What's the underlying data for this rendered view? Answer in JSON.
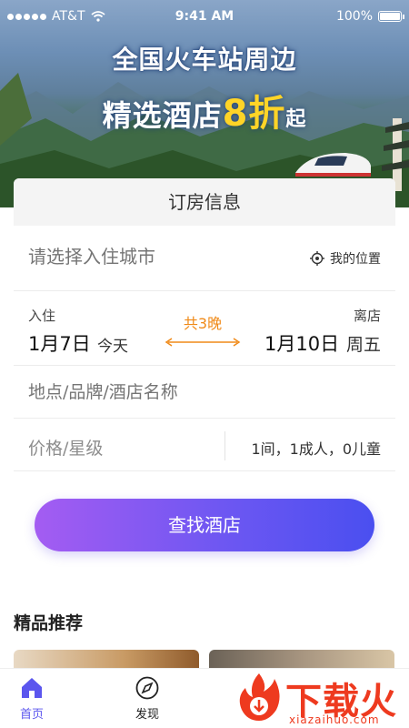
{
  "status_bar": {
    "carrier": "AT&T",
    "time": "9:41 AM",
    "battery": "100%"
  },
  "banner": {
    "line1": "全国火车站周边",
    "line2_prefix": "精选酒店",
    "line2_highlight": "8折",
    "line2_suffix": "起"
  },
  "booking": {
    "header": "订房信息",
    "city_placeholder": "请选择入住城市",
    "my_location": "我的位置",
    "checkin_label": "入住",
    "checkin_date": "1月7日",
    "checkin_day": "今天",
    "nights": "共3晚",
    "checkout_label": "离店",
    "checkout_date": "1月10日",
    "checkout_day": "周五",
    "keyword_placeholder": "地点/品牌/酒店名称",
    "price_label": "价格/星级",
    "guests": "1间，1成人，0儿童",
    "search_button": "查找酒店"
  },
  "recommend": {
    "title": "精品推荐"
  },
  "tabbar": {
    "home": "首页",
    "discover": "发现"
  },
  "watermark": {
    "text": "下载火",
    "url": "xiazaihuo.com"
  },
  "colors": {
    "accent": "#5b56ee",
    "orange": "#f08a18",
    "button_start": "#a45cf2",
    "button_end": "#4a4ff0"
  }
}
